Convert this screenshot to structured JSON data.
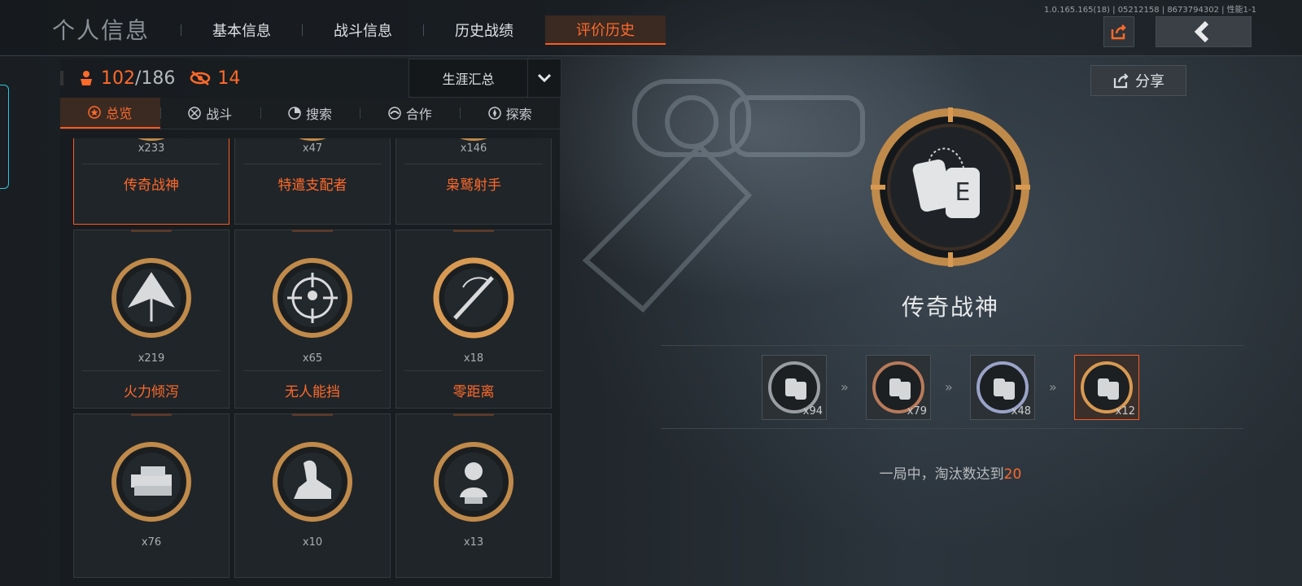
{
  "version": "1.0.165.165(18) | 05212158 | 8673794302 | 性能1-1",
  "header": {
    "title": "个人信息",
    "tabs": [
      {
        "label": "基本信息",
        "active": false
      },
      {
        "label": "战斗信息",
        "active": false
      },
      {
        "label": "历史战绩",
        "active": false
      },
      {
        "label": "评价历史",
        "active": true
      }
    ]
  },
  "share_label": "分享",
  "stats": {
    "owned": "102",
    "total": "/186",
    "new_count": "14"
  },
  "dropdown": {
    "selected": "生涯汇总"
  },
  "subtabs": [
    {
      "label": "总览",
      "icon": "star-icon",
      "active": true
    },
    {
      "label": "战斗",
      "icon": "crosshair-icon",
      "active": false
    },
    {
      "label": "搜索",
      "icon": "search-radar-icon",
      "active": false
    },
    {
      "label": "合作",
      "icon": "handshake-icon",
      "active": false
    },
    {
      "label": "探索",
      "icon": "compass-icon",
      "active": false
    }
  ],
  "cards": [
    {
      "name": "传奇战神",
      "count": "x233",
      "icon": "dog-tag-icon",
      "selected": true
    },
    {
      "name": "特遣支配者",
      "count": "x47",
      "icon": "skull-icon",
      "selected": false
    },
    {
      "name": "枭鹫射手",
      "count": "x146",
      "icon": "target-icon",
      "selected": false
    },
    {
      "name": "火力倾泻",
      "count": "x219",
      "icon": "chevron-up-icon",
      "selected": false
    },
    {
      "name": "无人能挡",
      "count": "x65",
      "icon": "crosshair-target-icon",
      "selected": false
    },
    {
      "name": "零距离",
      "count": "x18",
      "icon": "rifle-icon",
      "selected": false
    },
    {
      "name": "",
      "count": "x76",
      "icon": "money-stack-icon",
      "selected": false
    },
    {
      "name": "",
      "count": "x10",
      "icon": "sphinx-icon",
      "selected": false
    },
    {
      "name": "",
      "count": "x13",
      "icon": "bust-statue-icon",
      "selected": false
    }
  ],
  "detail": {
    "title": "传奇战神",
    "tiers": [
      {
        "count": "x94",
        "color": "#9a9ea2"
      },
      {
        "count": "x79",
        "color": "#b87a5a"
      },
      {
        "count": "x48",
        "color": "#9aa3c8"
      },
      {
        "count": "x12",
        "color": "#d89a52"
      }
    ],
    "description": "一局中，淘汰数达到",
    "description_value": "20"
  },
  "colors": {
    "accent": "#ff5a1f",
    "gold": "#c08a4a"
  }
}
